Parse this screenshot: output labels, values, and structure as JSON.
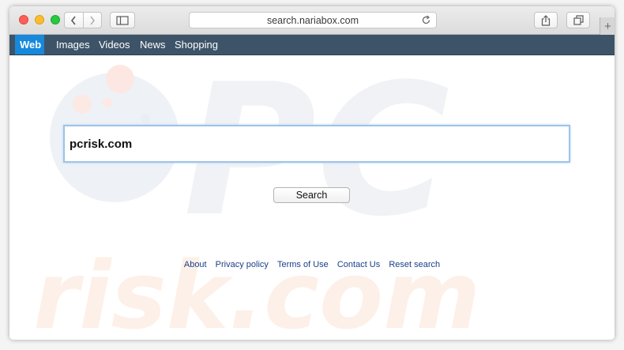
{
  "browser": {
    "url": "search.nariabox.com",
    "new_tab_symbol": "+"
  },
  "site_nav": {
    "items": [
      "Web",
      "Images",
      "Videos",
      "News",
      "Shopping"
    ],
    "active": "Web",
    "active_color": "#1689dc",
    "bar_color": "#3d5468"
  },
  "search": {
    "value": "pcrisk.com",
    "button_label": "Search"
  },
  "footer": {
    "links": [
      "About",
      "Privacy policy",
      "Terms of Use",
      "Contact Us",
      "Reset search"
    ]
  },
  "watermark": {
    "top": "PC",
    "bottom": "risk.com"
  },
  "icons": {
    "back": "chevron-left-icon",
    "forward": "chevron-right-icon",
    "sidebar": "sidebar-icon",
    "reload": "reload-icon",
    "share": "share-icon",
    "tabs": "tabs-overview-icon"
  }
}
